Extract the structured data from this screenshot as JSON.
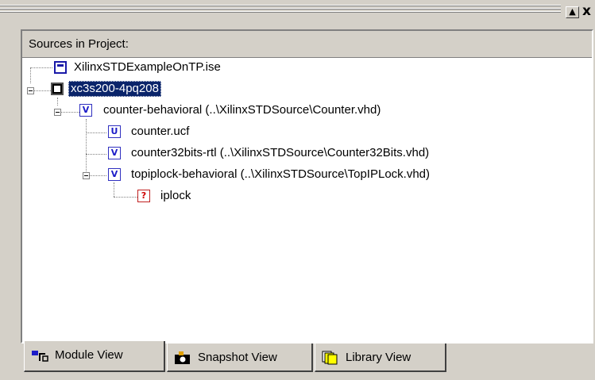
{
  "panel": {
    "header": "Sources in Project:",
    "close_glyph": "x",
    "scroll_up_glyph": "▲"
  },
  "tree": [
    {
      "label": "XilinxSTDExampleOnTP.ise",
      "icon": "ise-project-icon"
    },
    {
      "label": "xc3s200-4pq208",
      "icon": "chip-icon",
      "selected": true
    },
    {
      "label": "counter-behavioral (..\\XilinxSTDSource\\Counter.vhd)",
      "icon": "vhdl-file-icon"
    },
    {
      "label": "counter.ucf",
      "icon": "ucf-file-icon"
    },
    {
      "label": "counter32bits-rtl (..\\XilinxSTDSource\\Counter32Bits.vhd)",
      "icon": "vhdl-file-icon"
    },
    {
      "label": "topiplock-behavioral (..\\XilinxSTDSource\\TopIPLock.vhd)",
      "icon": "vhdl-file-icon"
    },
    {
      "label": "iplock",
      "icon": "unknown-file-icon"
    }
  ],
  "icon_glyphs": {
    "vhdl": "V",
    "ucf": "U",
    "unknown": "?"
  },
  "tabs": [
    {
      "label": "Module View",
      "icon": "module-view-icon",
      "active": true
    },
    {
      "label": "Snapshot View",
      "icon": "camera-icon",
      "active": false
    },
    {
      "label": "Library View",
      "icon": "library-icon",
      "active": false
    }
  ]
}
